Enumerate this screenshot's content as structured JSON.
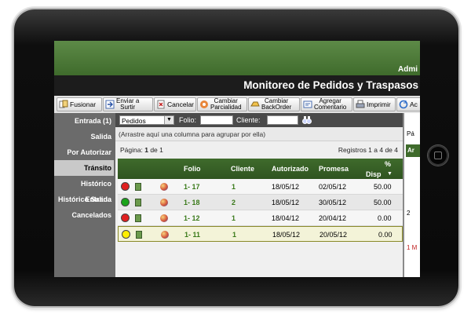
{
  "header": {
    "admin_text": "Admi",
    "title": "Monitoreo de Pedidos y Traspasos"
  },
  "toolbar": {
    "buttons": [
      {
        "label": "Fusionar",
        "icon": "merge-icon"
      },
      {
        "label": "Enviar a Surtir",
        "line1": "Enviar a",
        "line2": "Surtir",
        "icon": "send-icon"
      },
      {
        "label": "Cancelar",
        "icon": "cancel-icon"
      },
      {
        "label": "Cambiar Parcialidad",
        "line1": "Cambiar",
        "line2": "Parcialidad",
        "icon": "change-icon"
      },
      {
        "label": "Cambiar BackOrder",
        "line1": "Cambiar",
        "line2": "BackOrder",
        "icon": "backorder-icon"
      },
      {
        "label": "Agregar Comentario",
        "line1": "Agregar",
        "line2": "Comentario",
        "icon": "comment-icon"
      },
      {
        "label": "Imprimir",
        "icon": "print-icon"
      },
      {
        "label": "Ac",
        "icon": "update-icon"
      }
    ]
  },
  "sidebar": {
    "items": [
      {
        "label": "Entrada (1)"
      },
      {
        "label": "Salida"
      },
      {
        "label": "Por Autorizar"
      },
      {
        "label": "Tránsito",
        "active": true
      },
      {
        "label": "Histórico Entrada"
      },
      {
        "label": "Histórico Salida"
      },
      {
        "label": "Cancelados"
      }
    ]
  },
  "filters": {
    "type_value": "Pedidos",
    "folio_label": "Folio:",
    "cliente_label": "Cliente:"
  },
  "grid": {
    "group_hint": "(Arrastre aquí una columna para agrupar por ella)",
    "pager_label": "Página:",
    "pager_current": "1",
    "pager_of": "de 1",
    "records": "Registros 1 a 4 de 4",
    "columns": [
      "Folio",
      "Cliente",
      "Autorizado",
      "Promesa",
      "%",
      "Disp"
    ],
    "rows": [
      {
        "status": "red",
        "folio": "1- 17",
        "cliente": "1",
        "autorizado": "18/05/12",
        "promesa": "02/05/12",
        "disp": "50.00"
      },
      {
        "status": "green",
        "folio": "1- 18",
        "cliente": "2",
        "autorizado": "18/05/12",
        "promesa": "30/05/12",
        "disp": "50.00"
      },
      {
        "status": "red",
        "folio": "1- 12",
        "cliente": "1",
        "autorizado": "18/04/12",
        "promesa": "20/04/12",
        "disp": "0.00"
      },
      {
        "status": "yellow",
        "folio": "1- 11",
        "cliente": "1",
        "autorizado": "18/05/12",
        "promesa": "20/05/12",
        "disp": "0.00"
      }
    ]
  },
  "right_panel": {
    "label1": "Pá",
    "head": "Ar",
    "line_a": "2 ",
    "line_b": "1 M"
  },
  "colors": {
    "red": "#e02020",
    "green": "#1aa31a",
    "yellow": "#ffee00",
    "header_green": "#3f6b2c",
    "link_green": "#3a7a1a"
  }
}
